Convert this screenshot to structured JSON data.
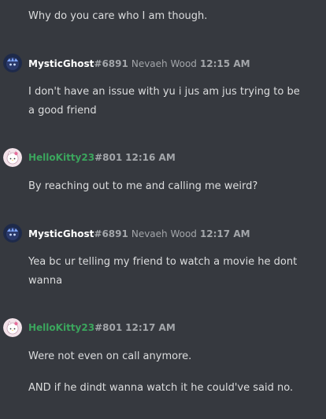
{
  "colors": {
    "background": "#36393f",
    "text": "#dcddde",
    "muted": "#a3a6aa",
    "user_mystic": "#ffffff",
    "user_hellokitty": "#3ba55d"
  },
  "messages": [
    {
      "text": "Why do you care who I am though."
    },
    {
      "author": "MysticGhost",
      "discriminator": "#6891",
      "nickname": "Nevaeh Wood",
      "time": "12:15 AM",
      "avatar_icon": "ghost-crown-avatar",
      "text": "I don't have an issue with yu i jus am jus trying to be a good friend"
    },
    {
      "author": "HelloKitty23",
      "discriminator": "#801",
      "time": "12:16 AM",
      "avatar_icon": "hello-kitty-avatar",
      "text": "By reaching out to me and calling me weird?"
    },
    {
      "author": "MysticGhost",
      "discriminator": "#6891",
      "nickname": "Nevaeh Wood",
      "time": "12:17 AM",
      "avatar_icon": "ghost-crown-avatar",
      "text": "Yea bc ur telling my friend to watch a movie he dont wanna"
    },
    {
      "author": "HelloKitty23",
      "discriminator": "#801",
      "time": "12:17 AM",
      "avatar_icon": "hello-kitty-avatar",
      "text": "Were not even on call anymore.",
      "followup": "AND if he dindt wanna watch it he could've said no."
    }
  ]
}
